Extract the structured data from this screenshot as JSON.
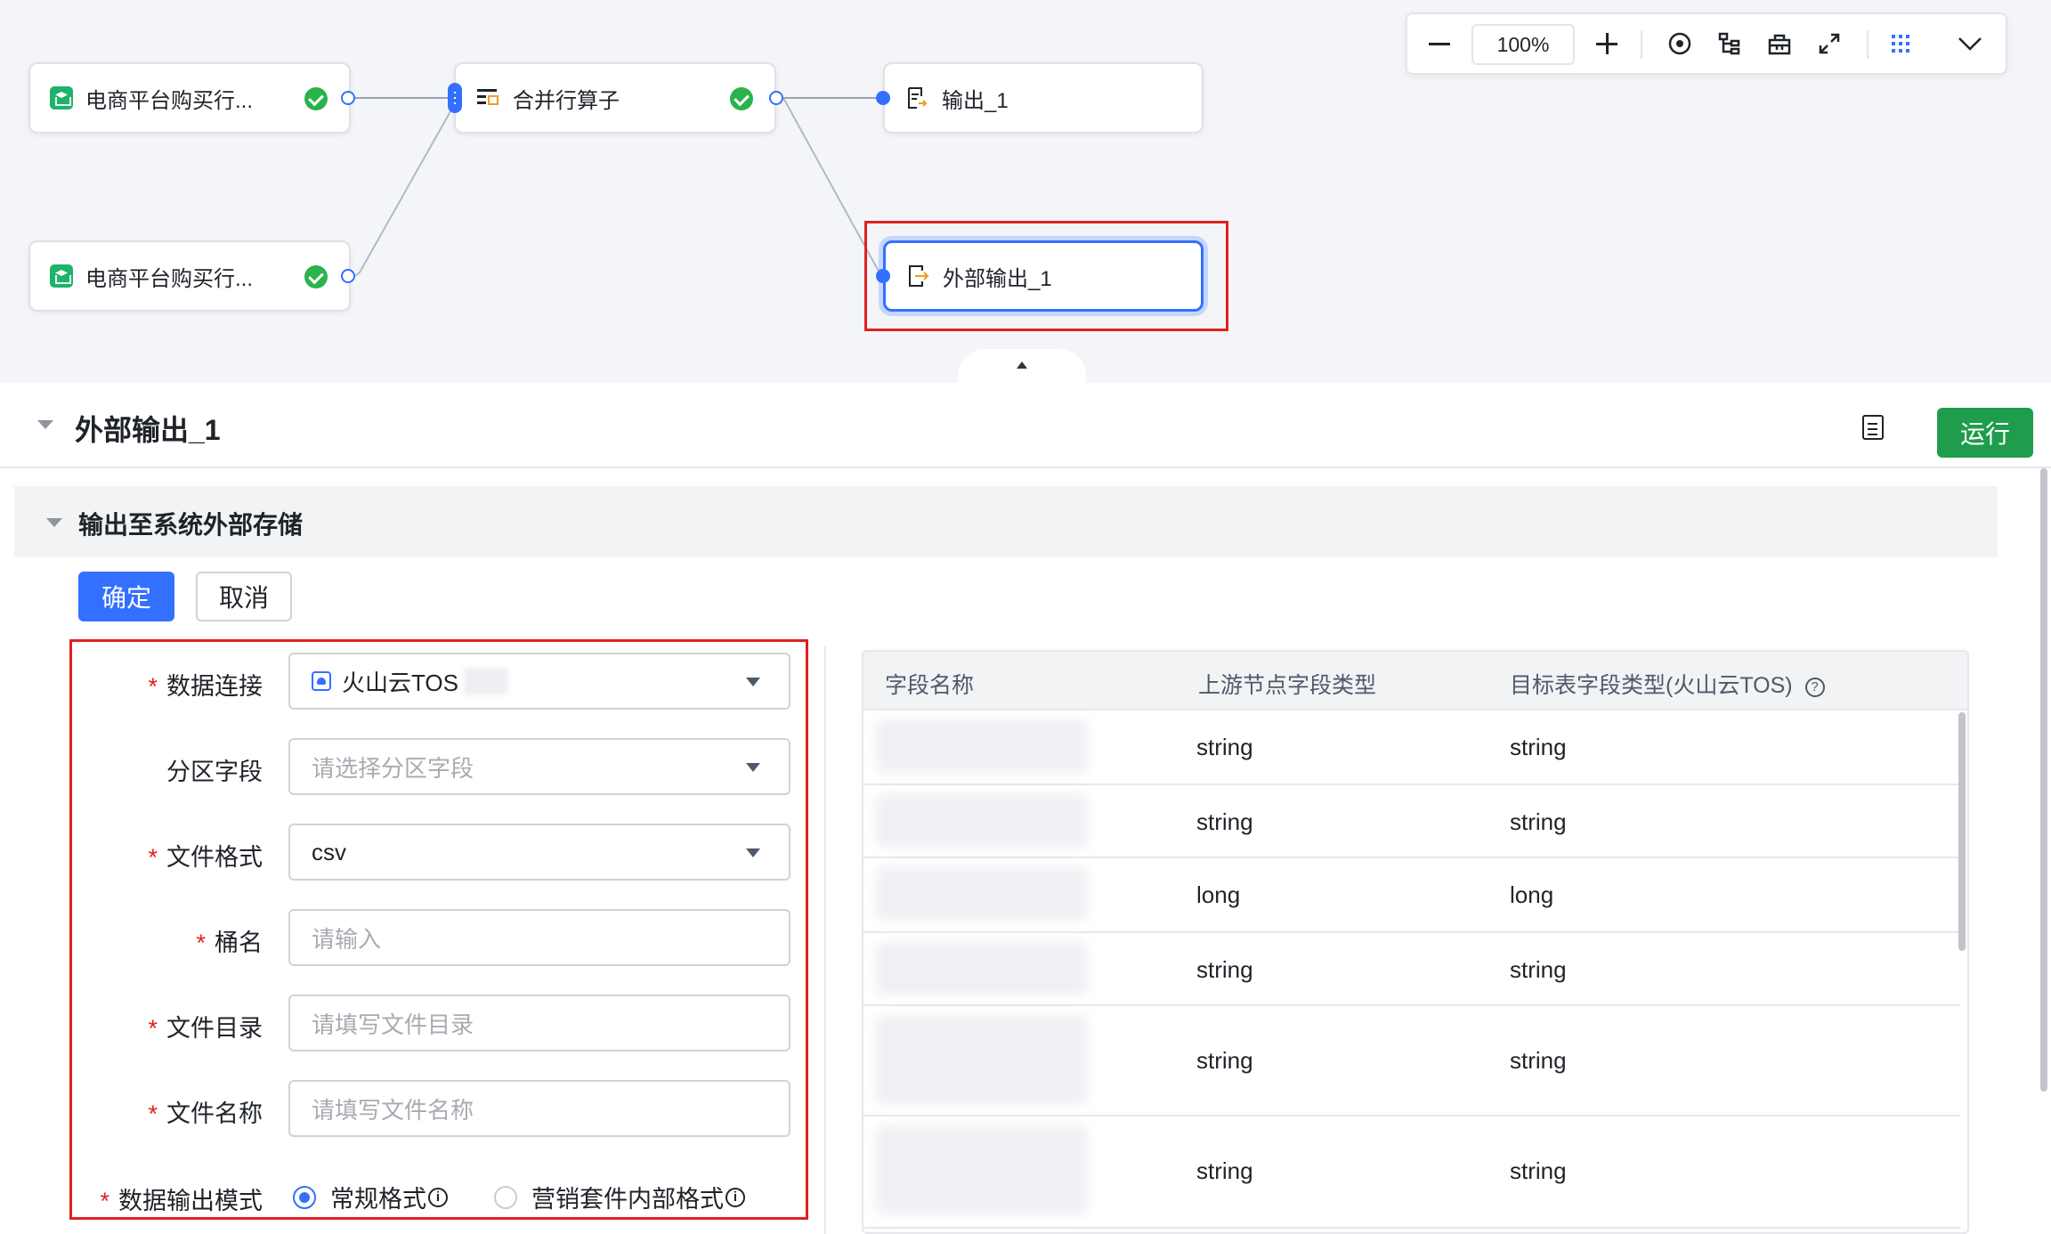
{
  "canvas": {
    "nodes": [
      {
        "id": "src1",
        "label": "电商平台购买行...",
        "icon": "database-icon"
      },
      {
        "id": "src2",
        "label": "电商平台购买行...",
        "icon": "database-icon"
      },
      {
        "id": "merge",
        "label": "合并行算子",
        "icon": "merge-operator-icon"
      },
      {
        "id": "out1",
        "label": "输出_1",
        "icon": "output-icon"
      },
      {
        "id": "ext1",
        "label": "外部输出_1",
        "icon": "external-output-icon"
      }
    ],
    "toolbar": {
      "zoom": "100%",
      "icons": [
        "zoom-out-icon",
        "zoom-in-icon",
        "locate-icon",
        "tree-layout-icon",
        "toolbox-icon",
        "fullscreen-icon",
        "grid-icon",
        "chevron-down-icon"
      ]
    }
  },
  "panel": {
    "title": "外部输出_1",
    "run_label": "运行",
    "section_title": "输出至系统外部存储",
    "confirm_label": "确定",
    "cancel_label": "取消"
  },
  "form": {
    "data_connection": {
      "label": "数据连接",
      "value": "火山云TOS"
    },
    "partition_field": {
      "label": "分区字段",
      "placeholder": "请选择分区字段"
    },
    "file_format": {
      "label": "文件格式",
      "value": "csv"
    },
    "bucket": {
      "label": "桶名",
      "placeholder": "请输入"
    },
    "file_dir": {
      "label": "文件目录",
      "placeholder": "请填写文件目录"
    },
    "file_name": {
      "label": "文件名称",
      "placeholder": "请填写文件名称"
    },
    "output_mode": {
      "label": "数据输出模式",
      "options": [
        "常规格式",
        "营销套件内部格式"
      ],
      "selected": "常规格式"
    }
  },
  "table": {
    "columns": [
      "字段名称",
      "上游节点字段类型",
      "目标表字段类型(火山云TOS)"
    ],
    "rows": [
      {
        "upstream": "string",
        "target": "string"
      },
      {
        "upstream": "string",
        "target": "string"
      },
      {
        "upstream": "long",
        "target": "long"
      },
      {
        "upstream": "string",
        "target": "string"
      },
      {
        "upstream": "string",
        "target": "string"
      },
      {
        "upstream": "string",
        "target": "string"
      }
    ]
  }
}
